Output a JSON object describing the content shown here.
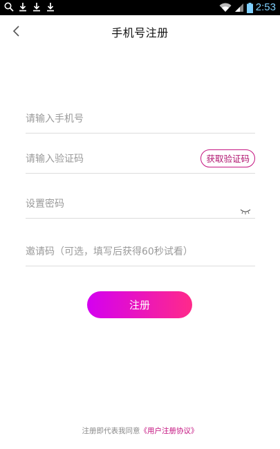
{
  "statusbar": {
    "time": "2:53",
    "icons": [
      "search-icon",
      "download-icon",
      "download-icon",
      "download-icon",
      "wifi-icon",
      "signal-icon",
      "battery-icon"
    ]
  },
  "header": {
    "title": "手机号注册",
    "back_icon": "chevron-left-icon"
  },
  "form": {
    "phone_placeholder": "请输入手机号",
    "code_placeholder": "请输入验证码",
    "get_code_label": "获取验证码",
    "password_placeholder": "设置密码",
    "invite_placeholder": "邀请码（可选，填写后获得60秒试看）",
    "eye_icon": "eye-closed-icon"
  },
  "actions": {
    "register_label": "注册"
  },
  "agreement": {
    "prefix": "注册即代表我同意",
    "link": "《用户注册协议》"
  },
  "colors": {
    "accent": "#c4127f",
    "gradient_start": "#d400f0",
    "gradient_end": "#ff2a8a"
  }
}
